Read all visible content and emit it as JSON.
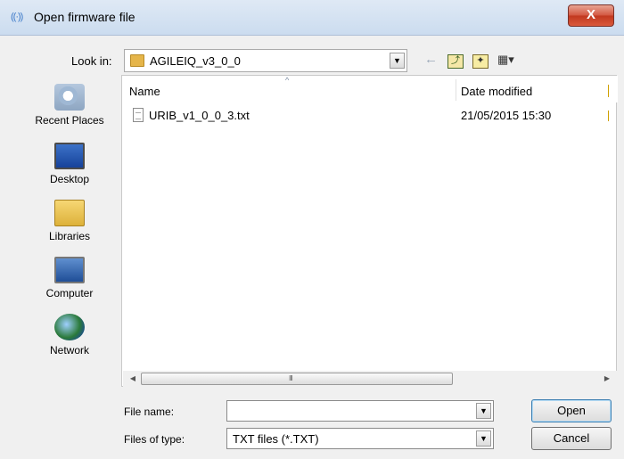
{
  "window": {
    "title": "Open firmware file",
    "title_icon": "radio-waves-icon",
    "close_label": "X"
  },
  "lookin": {
    "label": "Look in:",
    "value": "AGILEIQ_v3_0_0",
    "arrow": "▼"
  },
  "toolbar": {
    "back": "←",
    "up": "⤴",
    "new_folder": "✦",
    "view_menu": "▦▾"
  },
  "places": [
    {
      "label": "Recent Places",
      "icon": "recent-places-icon"
    },
    {
      "label": "Desktop",
      "icon": "desktop-icon"
    },
    {
      "label": "Libraries",
      "icon": "libraries-icon"
    },
    {
      "label": "Computer",
      "icon": "computer-icon"
    },
    {
      "label": "Network",
      "icon": "network-icon"
    }
  ],
  "filelist": {
    "columns": {
      "name": "Name",
      "date": "Date modified"
    },
    "sort_indicator": "^",
    "files": [
      {
        "name": "URIB_v1_0_0_3.txt",
        "date": "21/05/2015 15:30"
      }
    ],
    "scroll": {
      "left": "◀",
      "grip": "III",
      "right": "▶"
    }
  },
  "filename": {
    "label": "File name:",
    "value": "",
    "arrow": "▼"
  },
  "filetype": {
    "label": "Files of type:",
    "value": "TXT files (*.TXT)",
    "arrow": "▼"
  },
  "buttons": {
    "open": "Open",
    "cancel": "Cancel"
  }
}
